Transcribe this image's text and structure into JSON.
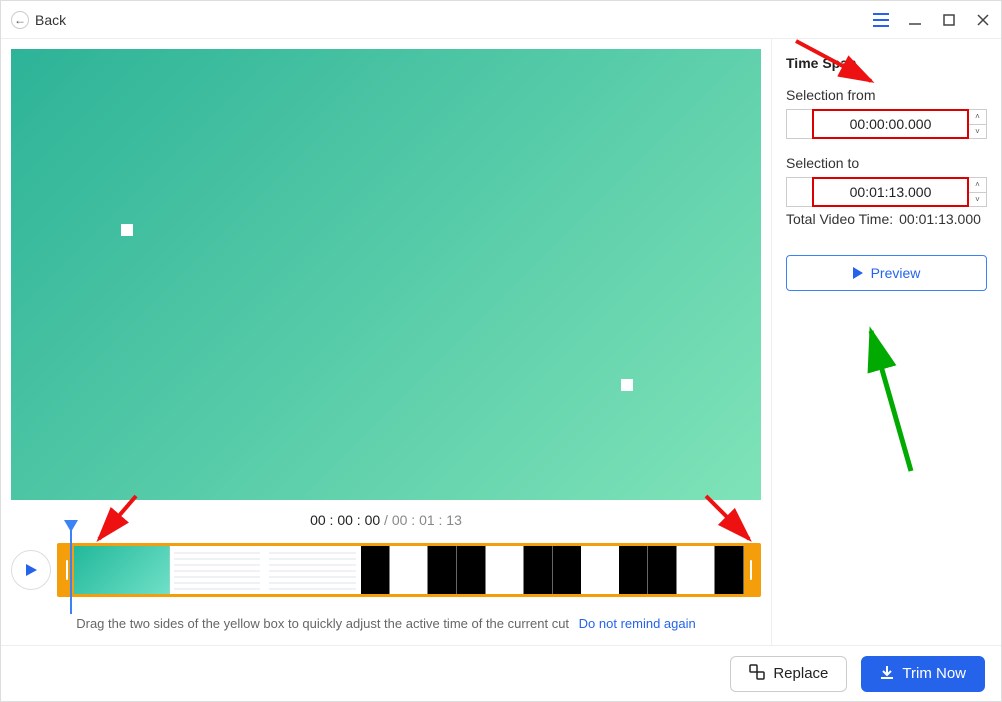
{
  "header": {
    "back_label": "Back"
  },
  "playback": {
    "current_time": "00 : 00 : 00",
    "total_time": "00 : 01 : 13"
  },
  "hint": {
    "text": "Drag the two sides of the yellow box to quickly adjust the active time of the current cut",
    "link": "Do not remind again"
  },
  "sidebar": {
    "title": "Time Span",
    "from_label": "Selection from",
    "from_value": "00:00:00.000",
    "to_label": "Selection to",
    "to_value": "00:01:13.000",
    "total_label": "Total Video Time:",
    "total_value": "00:01:13.000",
    "preview_label": "Preview"
  },
  "footer": {
    "replace_label": "Replace",
    "trim_label": "Trim Now"
  }
}
